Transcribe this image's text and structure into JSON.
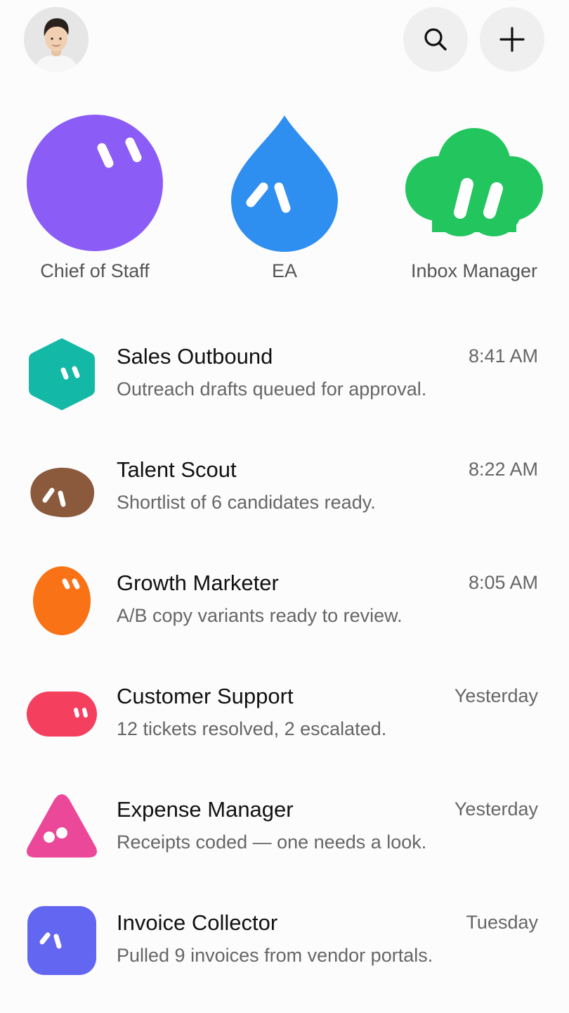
{
  "header": {
    "avatar": "avatar",
    "search_icon": "search-icon",
    "add_icon": "plus-icon"
  },
  "featured_agents": [
    {
      "label": "Chief of Staff",
      "color": "#8B5CF6",
      "icon": "purple-orb-icon"
    },
    {
      "label": "EA",
      "color": "#2F8FF0",
      "icon": "blue-drop-icon"
    },
    {
      "label": "Inbox Manager",
      "color": "#22C55E",
      "icon": "green-cloud-icon"
    }
  ],
  "conversations": [
    {
      "name": "Sales Outbound",
      "time": "8:41 AM",
      "preview": "Outreach drafts queued for approval.",
      "color": "#14B8A6",
      "icon": "teal-hexagon-icon"
    },
    {
      "name": "Talent Scout",
      "time": "8:22 AM",
      "preview": "Shortlist of 6 candidates ready.",
      "color": "#8B5A3C",
      "icon": "brown-blob-icon"
    },
    {
      "name": "Growth Marketer",
      "time": "8:05 AM",
      "preview": "A/B copy variants ready to review.",
      "color": "#F97316",
      "icon": "orange-egg-icon"
    },
    {
      "name": "Customer Support",
      "time": "Yesterday",
      "preview": "12 tickets resolved, 2 escalated.",
      "color": "#F43F5E",
      "icon": "red-pill-icon"
    },
    {
      "name": "Expense Manager",
      "time": "Yesterday",
      "preview": "Receipts coded — one needs a look.",
      "color": "#EC4899",
      "icon": "pink-triangle-icon"
    },
    {
      "name": "Invoice Collector",
      "time": "Tuesday",
      "preview": "Pulled 9 invoices from vendor portals.",
      "color": "#6366F1",
      "icon": "indigo-square-icon"
    }
  ]
}
